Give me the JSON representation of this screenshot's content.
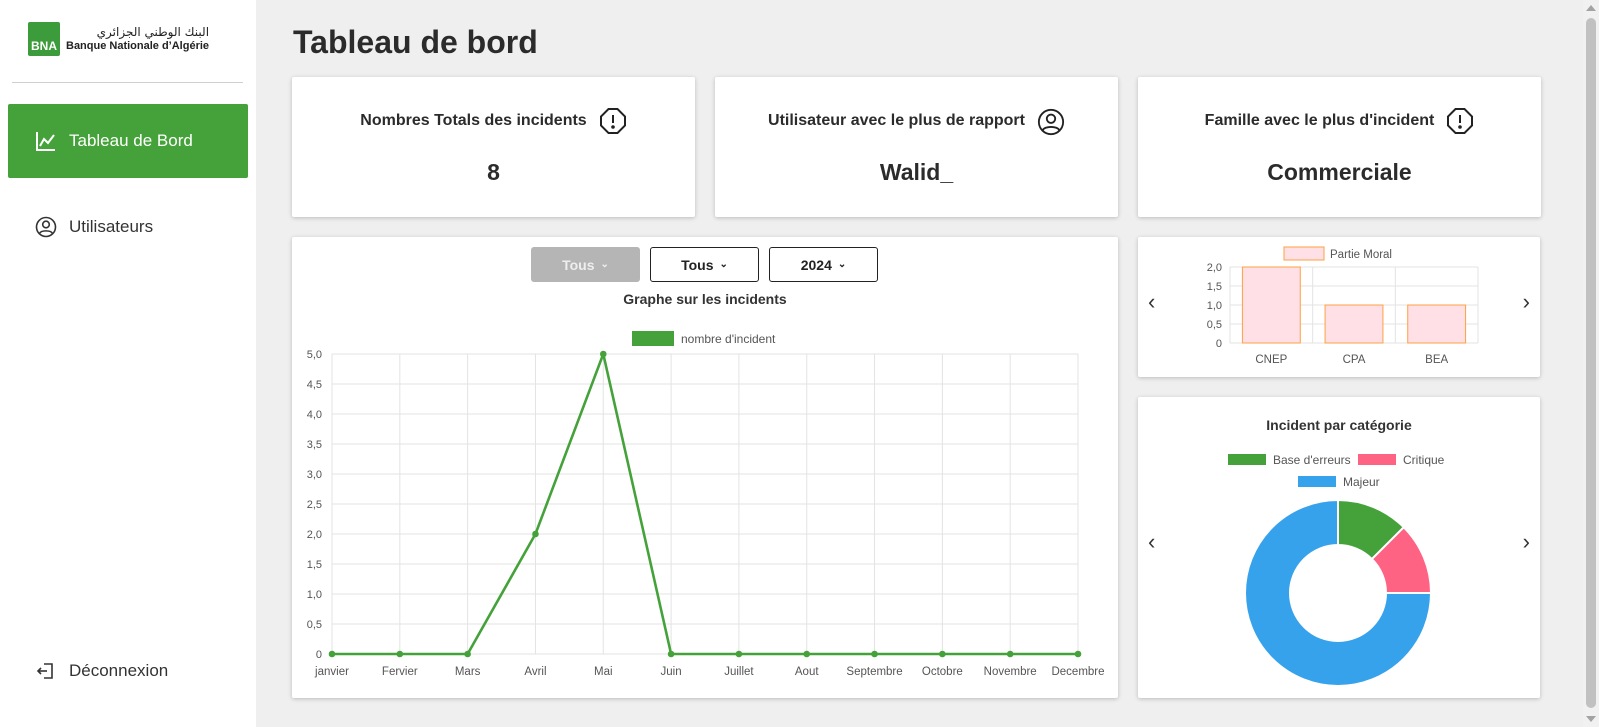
{
  "brand": {
    "arabic": "البنك الوطني الجزائري",
    "french": "Banque Nationale d’Algérie",
    "badge": "BNA"
  },
  "sidebar": {
    "items": [
      {
        "label": "Tableau de Bord",
        "icon": "chart-line-icon",
        "active": true
      },
      {
        "label": "Utilisateurs",
        "icon": "user-circle-icon",
        "active": false
      }
    ],
    "logout": {
      "label": "Déconnexion",
      "icon": "logout-icon"
    }
  },
  "page": {
    "title": "Tableau de bord"
  },
  "stats": [
    {
      "label": "Nombres Totals des incidents",
      "icon": "alert-circle-icon",
      "value": "8"
    },
    {
      "label": "Utilisateur avec le plus de rapport",
      "icon": "user-circle-icon",
      "value": "Walid_"
    },
    {
      "label": "Famille avec le plus d'incident",
      "icon": "alert-circle-icon",
      "value": "Commerciale"
    }
  ],
  "filters": [
    {
      "label": "Tous",
      "disabled": true
    },
    {
      "label": "Tous",
      "disabled": false
    },
    {
      "label": "2024",
      "disabled": false
    }
  ],
  "colors": {
    "green": "#45a23a",
    "pink": "#ff6384",
    "blue": "#36a2eb",
    "bar_fill": "#ffe0e6",
    "bar_border": "#ff9f40"
  },
  "chart_data": [
    {
      "type": "line",
      "title": "Graphe sur les incidents",
      "categories": [
        "janvier",
        "Fervier",
        "Mars",
        "Avril",
        "Mai",
        "Juin",
        "Juillet",
        "Aout",
        "Septembre",
        "Octobre",
        "Novembre",
        "Decembre"
      ],
      "series": [
        {
          "name": "nombre d'incident",
          "values": [
            0,
            0,
            0,
            2,
            5,
            0,
            0,
            0,
            0,
            0,
            0,
            0
          ]
        }
      ],
      "ylim": [
        0,
        5
      ],
      "yticks": [
        "0",
        "0,5",
        "1,0",
        "1,5",
        "2,0",
        "2,5",
        "3,0",
        "3,5",
        "4,0",
        "4,5",
        "5,0"
      ],
      "legend": "top",
      "grid": true
    },
    {
      "type": "bar",
      "categories": [
        "CNEP",
        "CPA",
        "BEA"
      ],
      "series": [
        {
          "name": "Partie Moral",
          "values": [
            2,
            1,
            1
          ]
        }
      ],
      "ylim": [
        0,
        2
      ],
      "yticks": [
        "0",
        "0,5",
        "1,0",
        "1,5",
        "2,0"
      ],
      "legend": "top",
      "grid": true
    },
    {
      "type": "pie",
      "title": "Incident par catégorie",
      "series": [
        {
          "name": "Base d'erreurs",
          "value": 1
        },
        {
          "name": "Critique",
          "value": 1
        },
        {
          "name": "Majeur",
          "value": 6
        }
      ],
      "legend": "top"
    }
  ],
  "nav_arrows": {
    "prev": "‹",
    "next": "›"
  }
}
